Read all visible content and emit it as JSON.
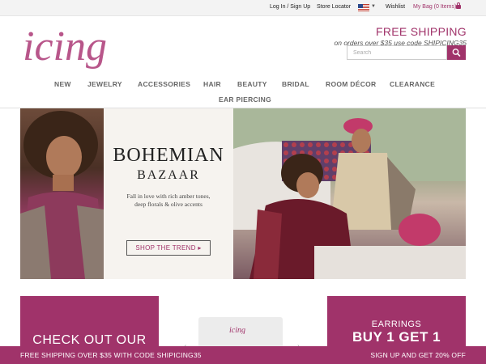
{
  "topbar": {
    "login": "Log In / Sign Up",
    "store_locator": "Store Locator",
    "wishlist": "Wishlist",
    "bag": "My Bag (0 Items)"
  },
  "header": {
    "logo_text": "icing",
    "free_shipping_title": "FREE SHIPPING",
    "free_shipping_sub": "on orders over $35 use code SHIPICING35",
    "search_placeholder": "Search"
  },
  "nav": {
    "items": [
      "NEW",
      "JEWELRY",
      "ACCESSORIES",
      "HAIR",
      "BEAUTY",
      "BRIDAL",
      "ROOM DÉCOR",
      "CLEARANCE",
      "EAR PIERCING"
    ]
  },
  "hero": {
    "title": "BOHEMIAN",
    "subtitle": "BAZAAR",
    "copy": "Fall in love with rich amber tones, deep florals & olive accents",
    "cta": "SHOP THE TREND ▸"
  },
  "promos": {
    "left_text": "CHECK OUT OUR",
    "card_logo": "icing",
    "right_line1": "EARRINGS",
    "right_line2": "BUY 1 GET 1"
  },
  "bottombar": {
    "left": "FREE SHIPPING OVER $35 WITH CODE SHIPICING35",
    "right": "SIGN UP AND GET 20% OFF"
  },
  "colors": {
    "accent": "#a0336a"
  }
}
